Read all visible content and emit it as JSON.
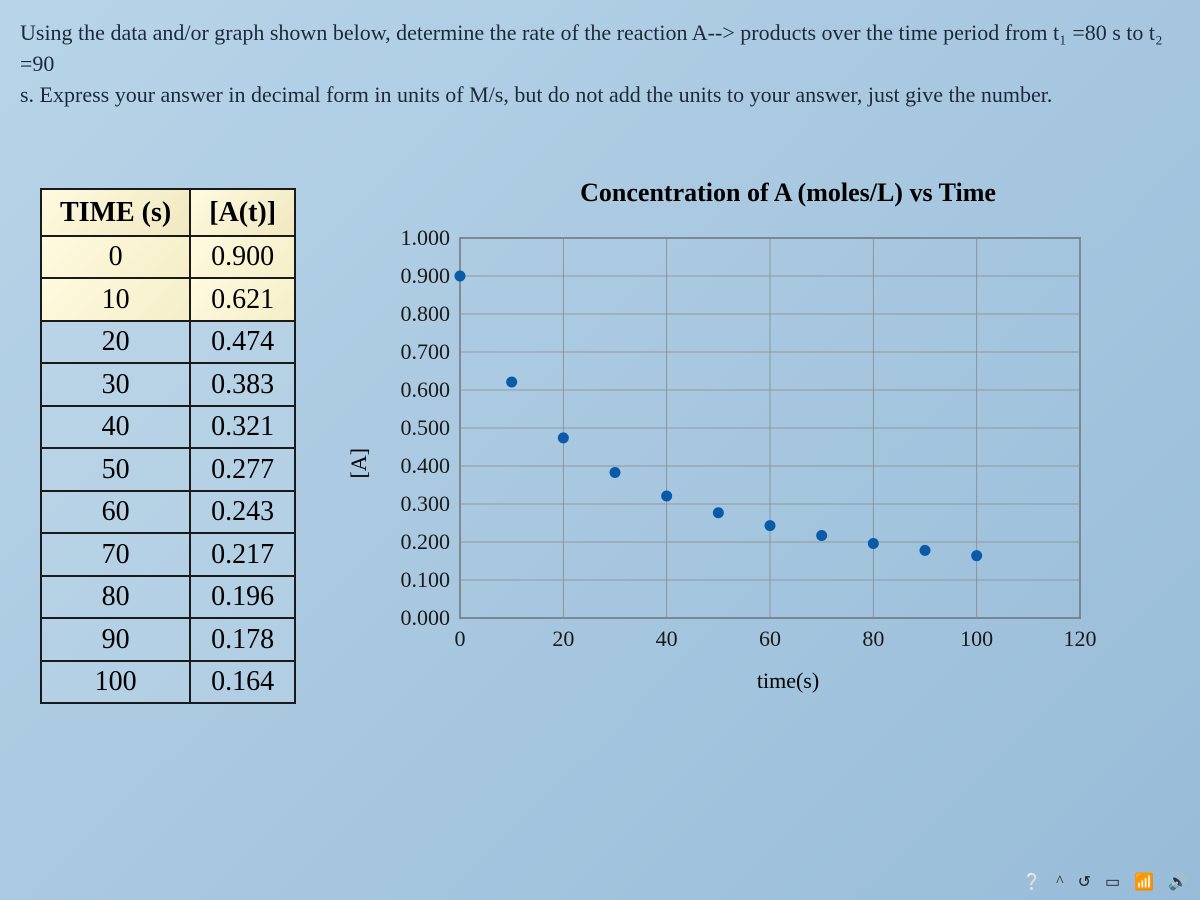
{
  "question": {
    "line1": "Using the data and/or graph shown below, determine the rate of the reaction A--> products over the time period from t₁ =80 s to t₂ =90",
    "line2": "s.  Express your answer in decimal form in units of M/s, but do not add the units to your answer, just give the number."
  },
  "table": {
    "headers": [
      "TIME (s)",
      "[A(t)]"
    ],
    "rows": [
      [
        "0",
        "0.900"
      ],
      [
        "10",
        "0.621"
      ],
      [
        "20",
        "0.474"
      ],
      [
        "30",
        "0.383"
      ],
      [
        "40",
        "0.321"
      ],
      [
        "50",
        "0.277"
      ],
      [
        "60",
        "0.243"
      ],
      [
        "70",
        "0.217"
      ],
      [
        "80",
        "0.196"
      ],
      [
        "90",
        "0.178"
      ],
      [
        "100",
        "0.164"
      ]
    ]
  },
  "chart_data": {
    "type": "scatter",
    "title": "Concentration of A (moles/L) vs Time",
    "xlabel": "time(s)",
    "ylabel": "[A]",
    "xlim": [
      0,
      120
    ],
    "ylim": [
      0.0,
      1.0
    ],
    "xticks": [
      0,
      20,
      40,
      60,
      80,
      100,
      120
    ],
    "yticks": [
      0.0,
      0.1,
      0.2,
      0.3,
      0.4,
      0.5,
      0.6,
      0.7,
      0.8,
      0.9,
      1.0
    ],
    "ytick_labels": [
      "0.000",
      "0.100",
      "0.200",
      "0.300",
      "0.400",
      "0.500",
      "0.600",
      "0.700",
      "0.800",
      "0.900",
      "1.000"
    ],
    "x": [
      0,
      10,
      20,
      30,
      40,
      50,
      60,
      70,
      80,
      90,
      100
    ],
    "y": [
      0.9,
      0.621,
      0.474,
      0.383,
      0.321,
      0.277,
      0.243,
      0.217,
      0.196,
      0.178,
      0.164
    ]
  },
  "taskbar": {
    "chevron": "^"
  }
}
